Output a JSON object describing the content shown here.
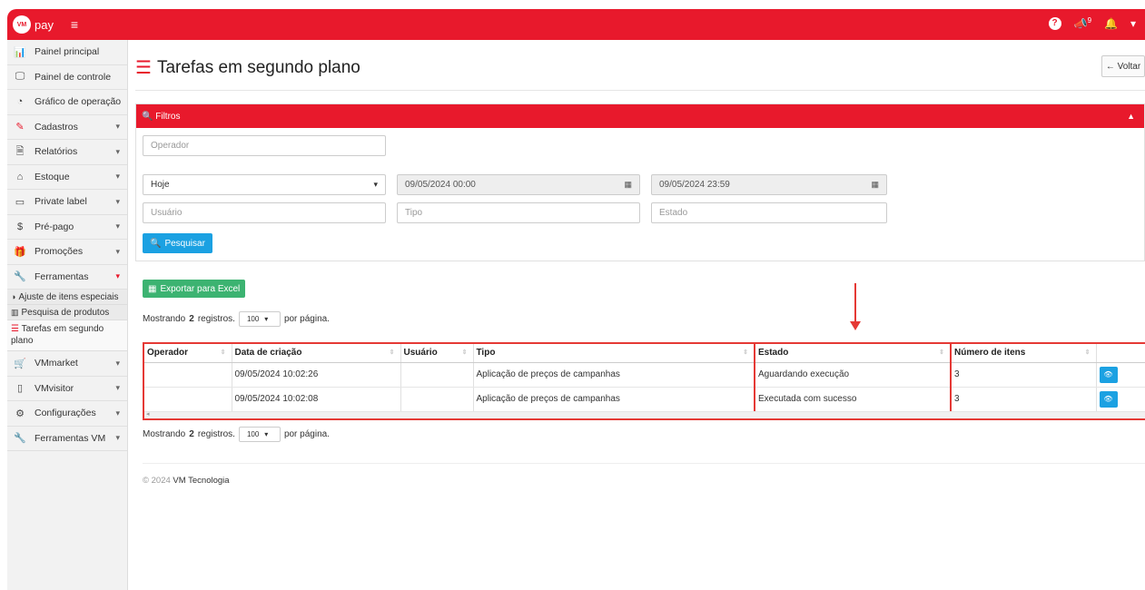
{
  "topbar": {
    "logo_badge": "VM",
    "brand": "pay",
    "notif_count": "9"
  },
  "sidebar": {
    "items": [
      {
        "label": "Painel principal"
      },
      {
        "label": "Painel de controle"
      },
      {
        "label": "Gráfico de operação"
      },
      {
        "label": "Cadastros"
      },
      {
        "label": "Relatórios"
      },
      {
        "label": "Estoque"
      },
      {
        "label": "Private label"
      },
      {
        "label": "Pré-pago"
      },
      {
        "label": "Promoções"
      },
      {
        "label": "Ferramentas"
      }
    ],
    "sub_items": [
      {
        "label": "Ajuste de itens especiais"
      },
      {
        "label": "Pesquisa de produtos"
      },
      {
        "label": "Tarefas em segundo plano"
      }
    ],
    "items_after": [
      {
        "label": "VMmarket"
      },
      {
        "label": "VMvisitor"
      },
      {
        "label": "Configurações"
      },
      {
        "label": "Ferramentas VM"
      }
    ]
  },
  "page": {
    "title": "Tarefas em segundo plano",
    "back_label": "Voltar"
  },
  "filters": {
    "title": "Filtros",
    "operador_placeholder": "Operador",
    "period_value": "Hoje",
    "date_start": "09/05/2024 00:00",
    "date_end": "09/05/2024 23:59",
    "usuario_placeholder": "Usuário",
    "tipo_placeholder": "Tipo",
    "estado_placeholder": "Estado",
    "search_label": "Pesquisar"
  },
  "export_label": "Exportar para Excel",
  "pager": {
    "prefix": "Mostrando",
    "count": "2",
    "mid": "registros.",
    "per_page": "100",
    "suffix": "por página."
  },
  "table": {
    "headers": [
      "Operador",
      "Data de criação",
      "Usuário",
      "Tipo",
      "Estado",
      "Número de itens"
    ],
    "rows": [
      {
        "operador": "",
        "data": "09/05/2024 10:02:26",
        "usuario": "",
        "tipo": "Aplicação de preços de campanhas",
        "estado": "Aguardando execução",
        "itens": "3"
      },
      {
        "operador": "",
        "data": "09/05/2024 10:02:08",
        "usuario": "",
        "tipo": "Aplicação de preços de campanhas",
        "estado": "Executada com sucesso",
        "itens": "3"
      }
    ]
  },
  "footer": {
    "copyright": "© 2024",
    "company": "VM Tecnologia"
  },
  "colors": {
    "brand_red": "#e8192c",
    "annotation_red": "#e53935",
    "blue": "#1ba1e2",
    "green": "#3cb371"
  }
}
